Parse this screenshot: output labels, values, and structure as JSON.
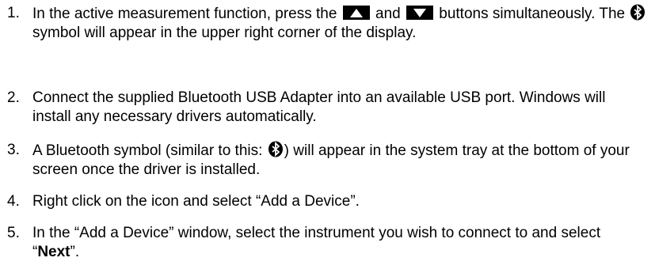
{
  "steps": [
    {
      "number": "1.",
      "part_a": "In the active measurement function, press the",
      "part_b": "and",
      "part_c": "buttons simultaneously. The",
      "part_d": "symbol will appear in the upper right corner of the display."
    },
    {
      "number": "2.",
      "text": "Connect the supplied Bluetooth USB Adapter into an available USB port. Windows will install any necessary drivers automatically."
    },
    {
      "number": "3.",
      "part_a": "A Bluetooth symbol (similar to this:",
      "part_b": ") will appear in the system tray at the bottom of your screen once the driver is installed."
    },
    {
      "number": "4.",
      "text": "Right click on the icon and select “Add a Device”."
    },
    {
      "number": "5.",
      "part_a": "In the “Add a Device” window, select the instrument you wish to connect to and select “",
      "bold": "Next",
      "part_b": "”."
    }
  ],
  "icons": {
    "up_button": "up-arrow-button-icon",
    "down_button": "down-arrow-button-icon",
    "bluetooth": "bluetooth-icon"
  },
  "colors": {
    "text": "#000000",
    "button_fill": "#000000",
    "button_glyph": "#ffffff"
  }
}
